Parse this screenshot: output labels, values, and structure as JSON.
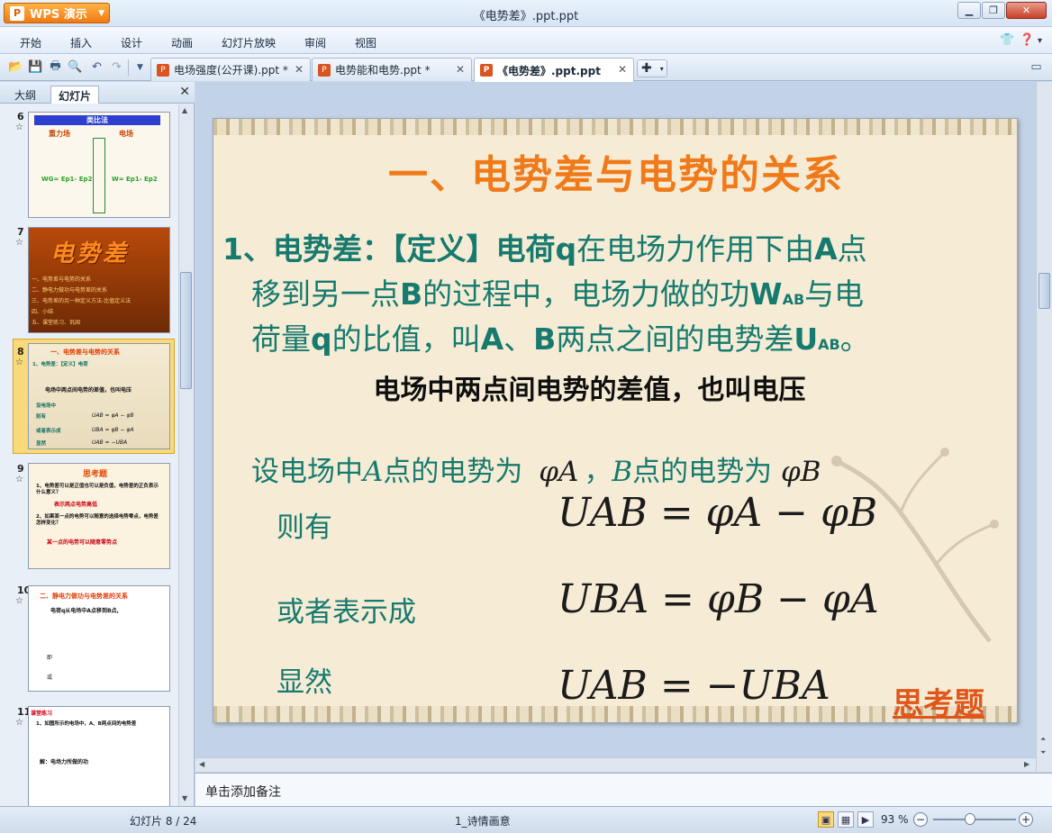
{
  "app": {
    "name": "WPS 演示",
    "window_title": "《电势差》.ppt.ppt"
  },
  "menu": [
    "开始",
    "插入",
    "设计",
    "动画",
    "幻灯片放映",
    "审阅",
    "视图"
  ],
  "doc_tabs": [
    {
      "label": "电场强度(公开课).ppt *",
      "active": false
    },
    {
      "label": "电势能和电势.ppt *",
      "active": false
    },
    {
      "label": "《电势差》.ppt.ppt",
      "active": true
    }
  ],
  "left_panel": {
    "tabs": [
      "大纲",
      "幻灯片"
    ],
    "active_tab": "幻灯片",
    "slides": [
      {
        "num": "6",
        "star": "☆",
        "title": "类比法",
        "left_col": "重力场",
        "right_col": "电场",
        "formula_l": "WG= Ep1- Ep2",
        "formula_r": "W= Ep1- Ep2"
      },
      {
        "num": "7",
        "star": "☆",
        "title": "电势差",
        "lines": [
          "一、电势差与电势的关系",
          "二、静电力做功与电势差的关系",
          "三、电势差的另一种定义方法-比值定义法",
          "四、小结",
          "五、课堂练习、巩固"
        ]
      },
      {
        "num": "8",
        "star": "☆",
        "title": "一、电势差与电势的关系",
        "selected": true
      },
      {
        "num": "9",
        "star": "☆",
        "title": "思考题",
        "lines": [
          "1、电势差可以是正值也可以是负值，电势差的正负表示什么意义？",
          "表示两点电势高低",
          "2、如果某一点的电势可以随意的选择电势零点，电势差怎样变化？",
          "某一点的电势可以随意零势点"
        ]
      },
      {
        "num": "10",
        "star": "☆",
        "title": "二、静电力做功与电势差的关系",
        "lines": [
          "电荷q从电场中A点移到B点,",
          "即",
          "或"
        ]
      },
      {
        "num": "11",
        "star": "☆",
        "title": "课堂练习",
        "lines": [
          "1、如图所示的电场中，A、B两点间的电势差",
          "解：电场力所做的功"
        ]
      }
    ]
  },
  "slide": {
    "title": "一、电势差与电势的关系",
    "def_line1_pre": "1、电势差：【定义】电荷",
    "def_line1_q": "q",
    "def_line1_mid": "在电场力作用下由",
    "def_line1_A": "A",
    "def_line1_end": "点",
    "def_line2_pre": "移到另一点",
    "def_line2_B": "B",
    "def_line2_mid": "的过程中，电场力做的功",
    "def_line2_W": "W",
    "def_line2_sub": "AB",
    "def_line2_end": "与电",
    "def_line3_pre": "荷量",
    "def_line3_q": "q",
    "def_line3_mid": "的比值，叫",
    "def_line3_A": "A",
    "def_line3_sep": "、",
    "def_line3_B": "B",
    "def_line3_mid2": "两点之间的电势差",
    "def_line3_U": "U",
    "def_line3_sub": "AB",
    "def_line3_end": "。",
    "voltage_note": "电场中两点间电势的差值，也叫电压",
    "potential_pre": "设电场中",
    "potential_A": "A",
    "potential_mid": "点的电势为",
    "potential_phiA": "φA",
    "potential_comma": "，",
    "potential_B": "B",
    "potential_mid2": "点的电势为",
    "potential_phiB": "φB",
    "label_then": "则有",
    "label_or": "或者表示成",
    "label_obvious": "显然",
    "formula1": "UAB = φA − φB",
    "formula2": "UBA = φB − φA",
    "formula3": "UAB = −UBA",
    "link_think": "思考题"
  },
  "notes_placeholder": "单击添加备注",
  "status": {
    "slide_counter": "幻灯片 8 / 24",
    "theme": "1_诗情画意",
    "zoom": "93 %"
  }
}
